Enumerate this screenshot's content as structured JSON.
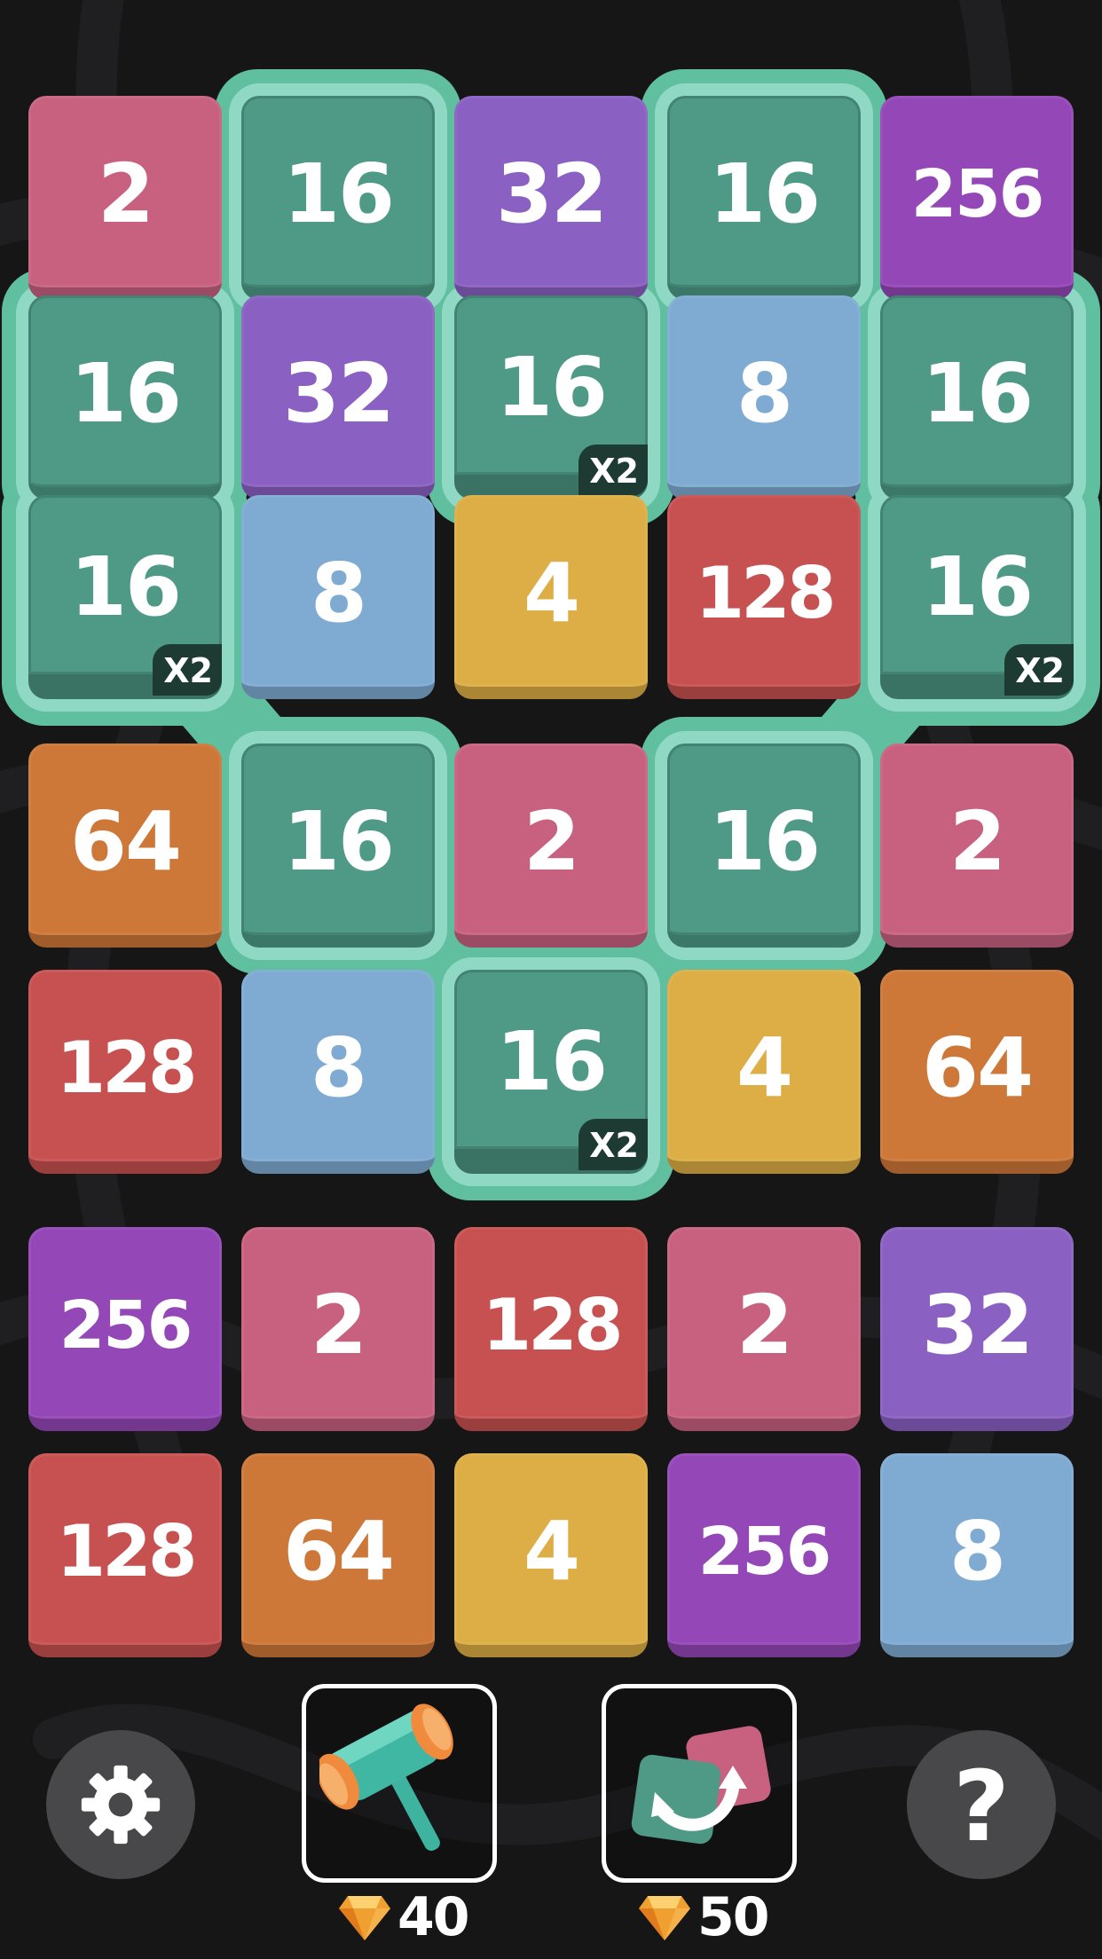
{
  "board": {
    "rows": [
      [
        "2",
        "16",
        "32",
        "16",
        "256"
      ],
      [
        "16",
        "32",
        "16",
        "8",
        "16"
      ],
      [
        "16",
        "8",
        "4",
        "128",
        "16"
      ],
      [
        "64",
        "16",
        "2",
        "16",
        "2"
      ],
      [
        "128",
        "8",
        "16",
        "4",
        "64"
      ],
      [
        "256",
        "2",
        "128",
        "2",
        "32"
      ],
      [
        "128",
        "64",
        "4",
        "256",
        "8"
      ]
    ],
    "multiplier_label": "X2",
    "highlighted_value": "16"
  },
  "tile_colors": {
    "2": "#c7617f",
    "4": "#dcae45",
    "8": "#7fabd3",
    "16": "#4e9a86",
    "32": "#8a60c2",
    "64": "#cd7838",
    "128": "#c75150",
    "256": "#9447b7"
  },
  "highlight_color": "#5fbf9f",
  "toolbar": {
    "settings_icon": "gear-icon",
    "hammer": {
      "icon": "hammer-icon",
      "cost": "40",
      "currency_icon": "diamond-icon"
    },
    "swap": {
      "icon": "swap-icon",
      "cost": "50",
      "currency_icon": "diamond-icon"
    },
    "help": {
      "icon": "question-icon",
      "label": "?"
    }
  }
}
